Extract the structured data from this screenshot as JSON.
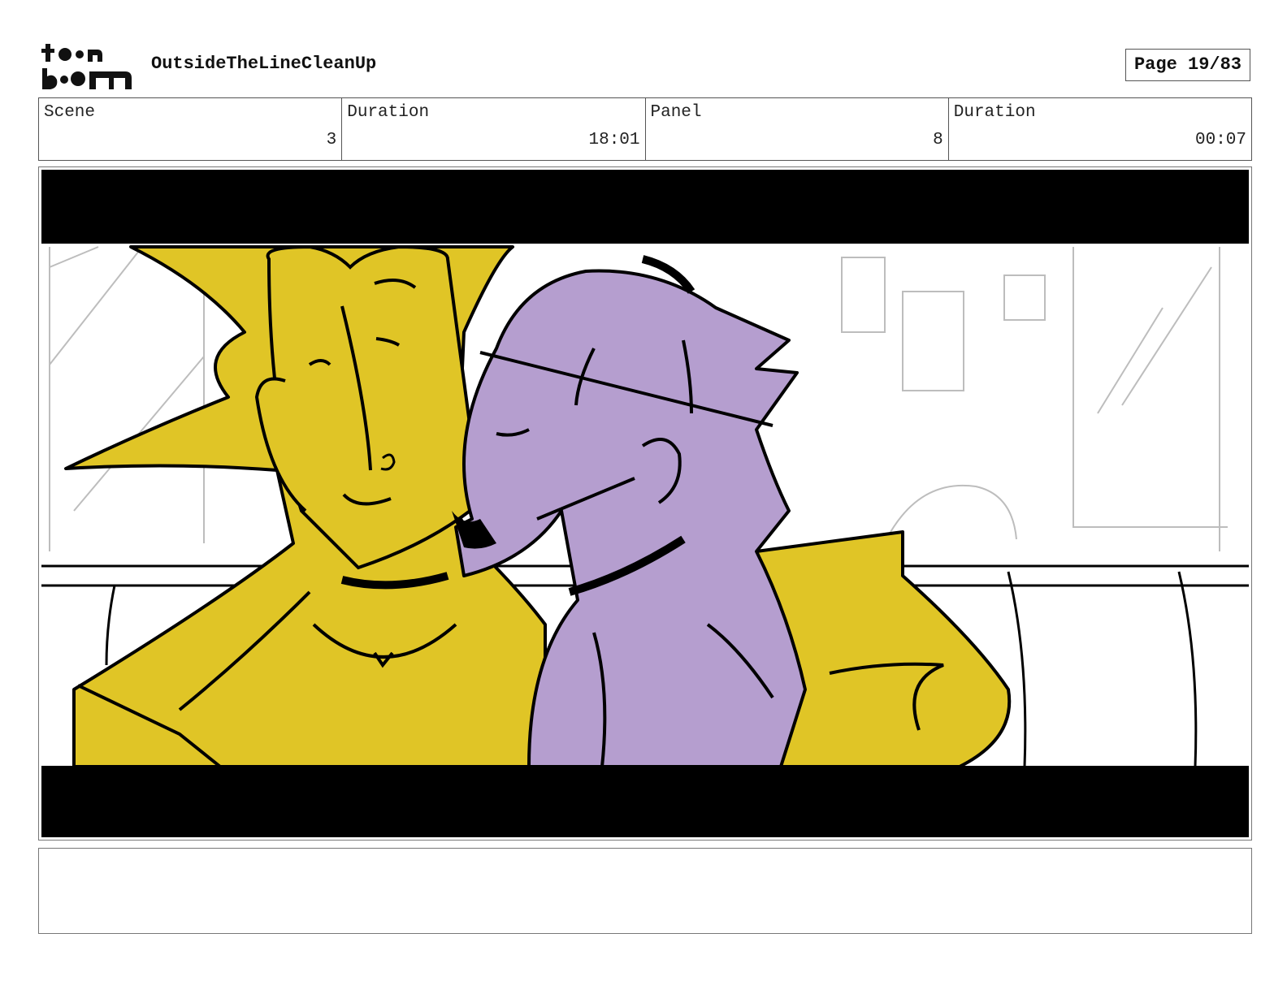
{
  "header": {
    "logo_text": "toon boom",
    "project_title": "OutsideTheLineCleanUp",
    "page_label": "Page 19/83"
  },
  "info": {
    "scene_label": "Scene",
    "scene_value": "3",
    "scene_duration_label": "Duration",
    "scene_duration_value": "18:01",
    "panel_label": "Panel",
    "panel_value": "8",
    "panel_duration_label": "Duration",
    "panel_duration_value": "00:07"
  },
  "panel": {
    "image_name": "storyboard-panel-art"
  },
  "colors": {
    "yellow": "#e0c526",
    "purple": "#b59ecf",
    "ink": "#000000"
  }
}
